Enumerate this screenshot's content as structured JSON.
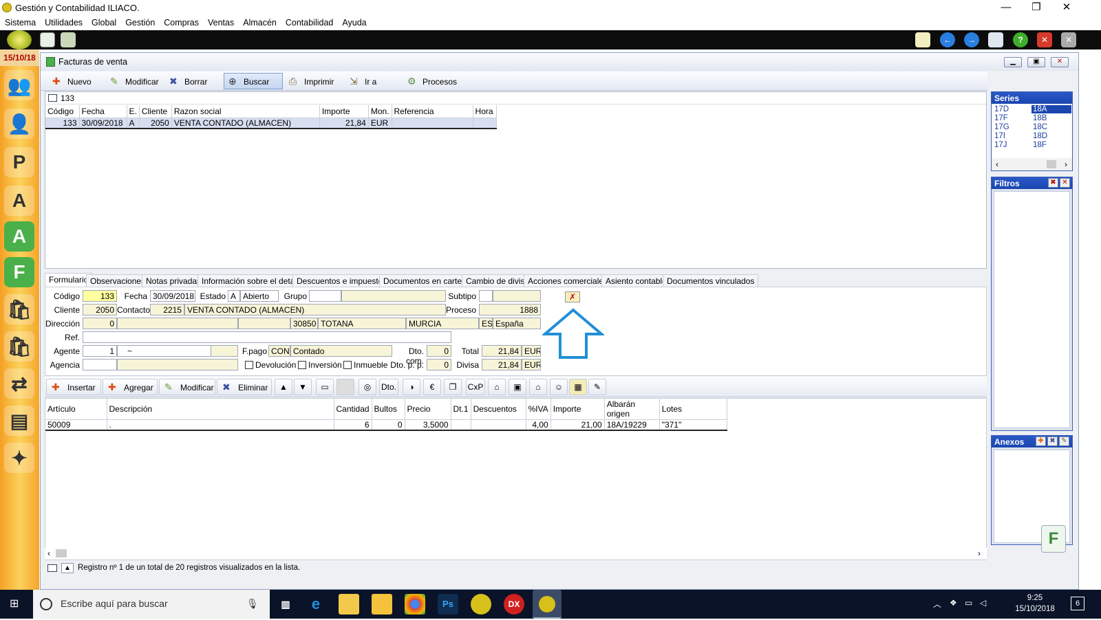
{
  "app": {
    "title": "Gestión y Contabilidad ILIACO.",
    "menu": [
      "Sistema",
      "Utilidades",
      "Global",
      "Gestión",
      "Compras",
      "Ventas",
      "Almacén",
      "Contabilidad",
      "Ayuda"
    ],
    "date": "15/10/18"
  },
  "window": {
    "title": "Facturas de venta",
    "toolbar": [
      "Nuevo",
      "Modificar",
      "Borrar",
      "Buscar",
      "Imprimir",
      "Ir a",
      "Procesos"
    ],
    "selected_tool": "Buscar"
  },
  "search": {
    "value": "133"
  },
  "list": {
    "columns": [
      "Código",
      "Fecha",
      "E.",
      "Cliente",
      "Razon social",
      "Importe",
      "Mon.",
      "Referencia",
      "Hora"
    ],
    "rows": [
      [
        "133",
        "30/09/2018",
        "A",
        "2050",
        "VENTA CONTADO (ALMACEN)",
        "21,84",
        "EUR",
        "",
        ""
      ]
    ]
  },
  "series": {
    "title": "Series",
    "col1": [
      "17D",
      "17F",
      "17G",
      "17I",
      "17J"
    ],
    "col2": [
      "18A",
      "18B",
      "18C",
      "18D",
      "18F"
    ],
    "selected": "18A"
  },
  "filtros": {
    "title": "Filtros"
  },
  "anexos": {
    "title": "Anexos"
  },
  "tabs": [
    "Formulario",
    "Observaciones",
    "Notas privadas",
    "Información sobre el detalle",
    "Descuentos e impuestos",
    "Documentos en cartera",
    "Cambio de divisa",
    "Acciones comerciales",
    "Asiento contable",
    "Documentos vinculados"
  ],
  "form": {
    "codigo_label": "Código",
    "codigo": "133",
    "fecha_label": "Fecha",
    "fecha": "30/09/2018",
    "estado_label": "Estado",
    "estado_code": "A",
    "estado": "Abierto",
    "grupo_label": "Grupo",
    "grupo": "",
    "subtipo_label": "Subtipo",
    "subtipo": "",
    "cliente_label": "Cliente",
    "cliente": "2050",
    "contacto_label": "Contacto",
    "contacto": "2215",
    "contacto_name": "VENTA CONTADO (ALMACEN)",
    "proceso_label": "Proceso",
    "proceso": "1888",
    "direccion_label": "Dirección",
    "direccion": "0",
    "cp": "30850",
    "poblacion": "TOTANA",
    "provincia": "MURCIA",
    "pais_code": "ES",
    "pais": "España",
    "ref_label": "Ref.",
    "ref": "",
    "agente_label": "Agente",
    "agente": "1",
    "agente_name": "~",
    "fpago_label": "F.pago",
    "fpago_code": "CON",
    "fpago": "Contado",
    "dtocom_label": "Dto. com.",
    "dtocom": "0",
    "total_label": "Total",
    "total": "21,84",
    "total_cur": "EUR",
    "agencia_label": "Agencia",
    "agencia": "",
    "devolucion": "Devolución",
    "inversion": "Inversión",
    "inmueble": "Inmueble",
    "dtopp_label": "Dto. p. p.",
    "dtopp": "0",
    "divisa_label": "Divisa",
    "divisa": "21,84",
    "divisa_cur": "EUR"
  },
  "detail_toolbar": {
    "insertar": "Insertar",
    "agregar": "Agregar",
    "modificar": "Modificar",
    "eliminar": "Eliminar",
    "dto": "Dto.",
    "cxp": "CxP"
  },
  "detail": {
    "columns": [
      "Artículo",
      "Descripción",
      "Cantidad",
      "Bultos",
      "Precio",
      "Dt.1",
      "Descuentos",
      "%IVA",
      "Importe",
      "Albarán origen",
      "Lotes"
    ],
    "rows": [
      [
        "50009",
        ".",
        "6",
        "0",
        "3,5000",
        "",
        "",
        "4,00",
        "21,00",
        "18A/19229",
        "\"371\""
      ]
    ]
  },
  "status": "Registro nº 1 de un total de 20 registros visualizados en la lista.",
  "taskbar": {
    "search_placeholder": "Escribe aquí para buscar",
    "time": "9:25",
    "date": "15/10/2018",
    "notifications": "6"
  },
  "colors": {
    "accent": "#1b46b0",
    "arrow": "#1f8fd6",
    "leftbar": "#f6b23a"
  }
}
